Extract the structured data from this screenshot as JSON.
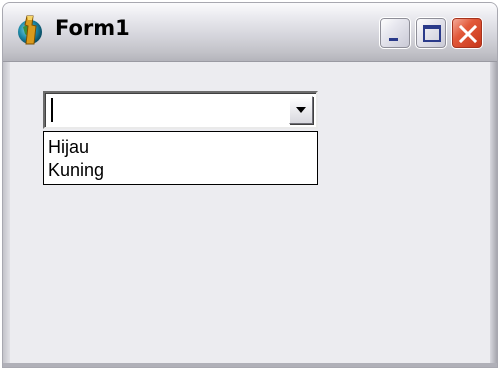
{
  "window": {
    "title": "Form1",
    "icon": "delphi-app-icon",
    "buttons": {
      "minimize_icon": "minimize-icon",
      "maximize_icon": "maximize-icon",
      "close_icon": "close-icon"
    }
  },
  "combobox": {
    "value": "",
    "dropdown_open": true,
    "options": [
      "Hijau",
      "Kuning"
    ]
  },
  "colors": {
    "client_bg": "#ececf0",
    "close_button": "#e2593a"
  }
}
